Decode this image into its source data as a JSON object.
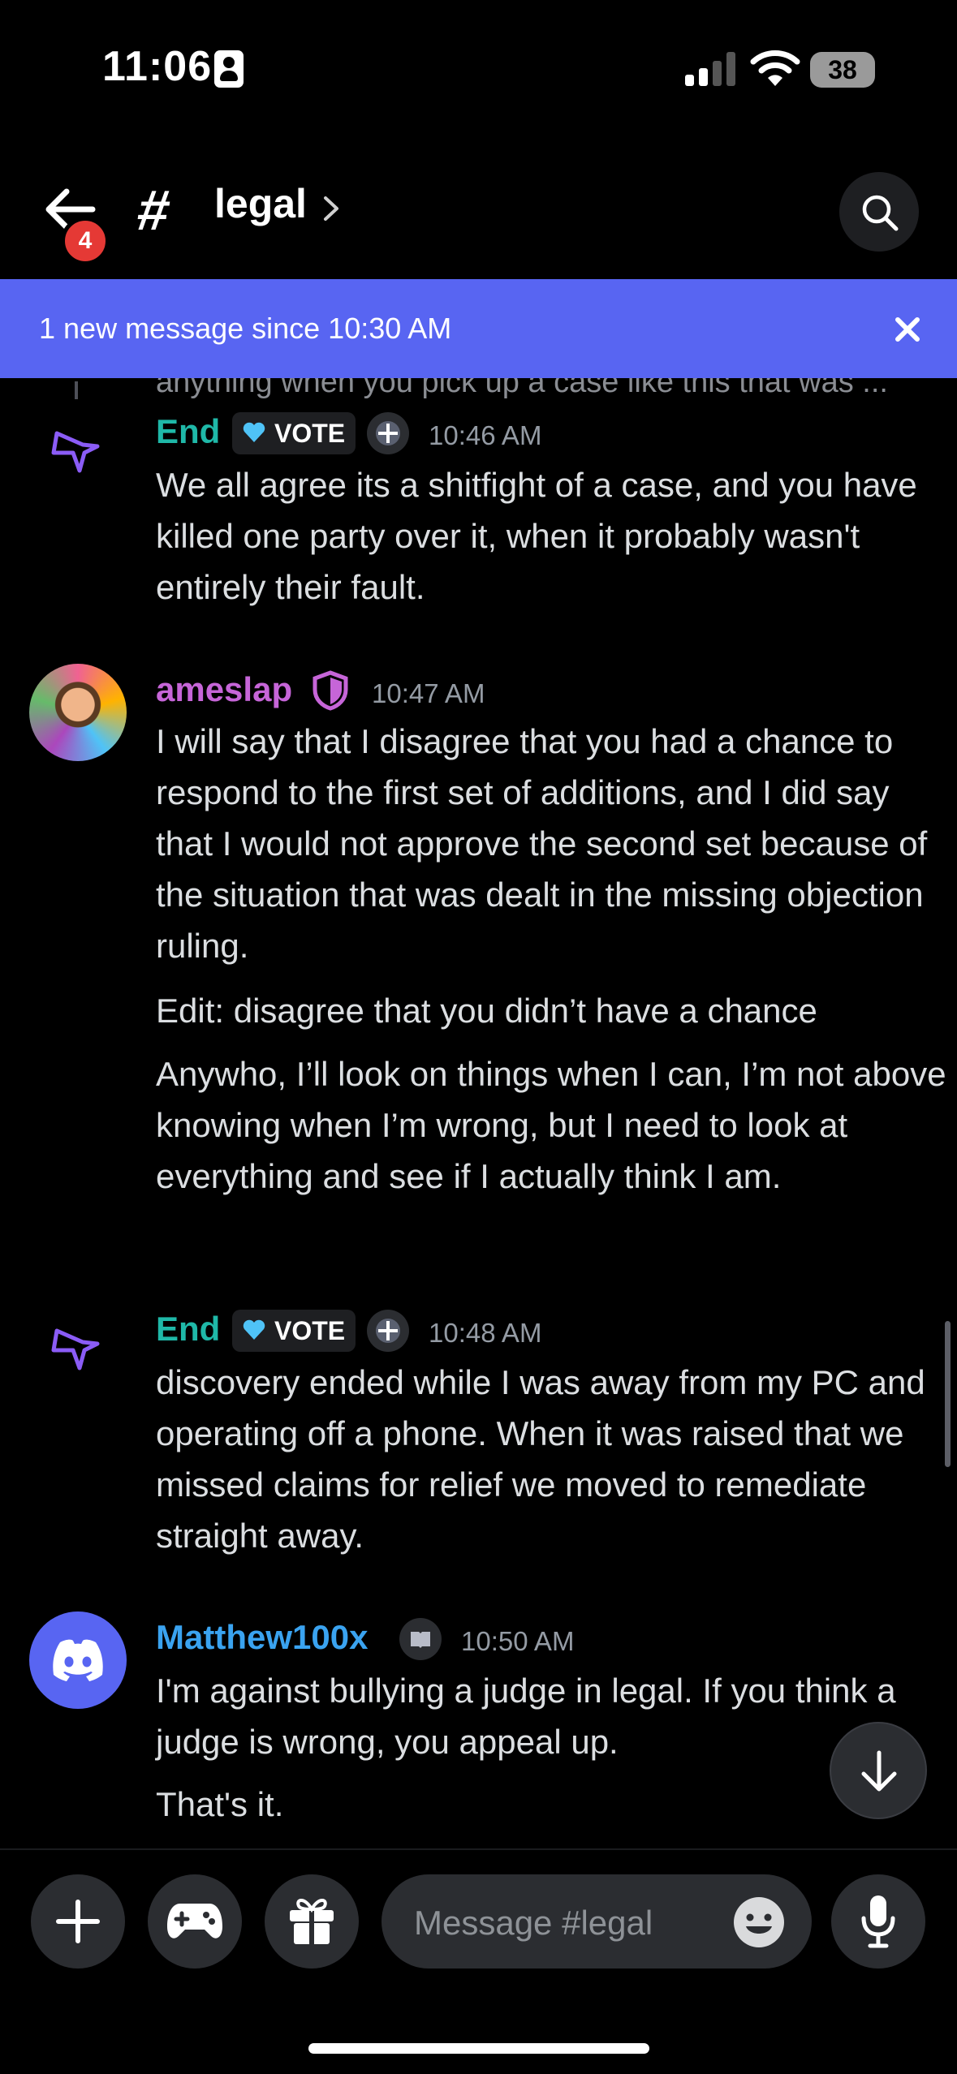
{
  "status_bar": {
    "time": "11:06",
    "battery": "38"
  },
  "header": {
    "channel_name": "legal",
    "unread_badge": "4"
  },
  "banner": {
    "text": "1 new message since 10:30 AM"
  },
  "clipped_previous": "anything when you pick up a case like this that was ...",
  "messages": [
    {
      "author": "End",
      "author_color": "#1fb8a8",
      "tag": "VOTE",
      "time": "10:46 AM",
      "paragraphs": [
        "We all agree its a shitfight of a case, and you have killed one party over it, when it probably wasn't entirely their fault."
      ]
    },
    {
      "author": "ameslap",
      "author_color": "#c665d8",
      "time": "10:47 AM",
      "paragraphs": [
        "I will say that I disagree that you had a chance to respond to the first set of additions, and I did say that I would not approve the second set because of the situation that was dealt in the missing objection ruling.",
        "Edit: disagree that you didn’t have a chance",
        "Anywho, I’ll look on things when I can, I’m not above knowing when I’m wrong, but I need to look at everything and see if I actually think I am."
      ]
    },
    {
      "author": "End",
      "author_color": "#1fb8a8",
      "tag": "VOTE",
      "time": "10:48 AM",
      "paragraphs": [
        "discovery ended while I was away from my PC and operating off a phone. When it was raised that we missed claims for relief we moved to remediate straight away."
      ]
    },
    {
      "author": "Matthew100x",
      "author_color": "#3aa3f0",
      "time": "10:50 AM",
      "paragraphs": [
        "I'm against bullying a judge in legal. If you think a judge is wrong, you appeal up.",
        "That's it."
      ]
    }
  ],
  "composer": {
    "placeholder": "Message #legal"
  }
}
